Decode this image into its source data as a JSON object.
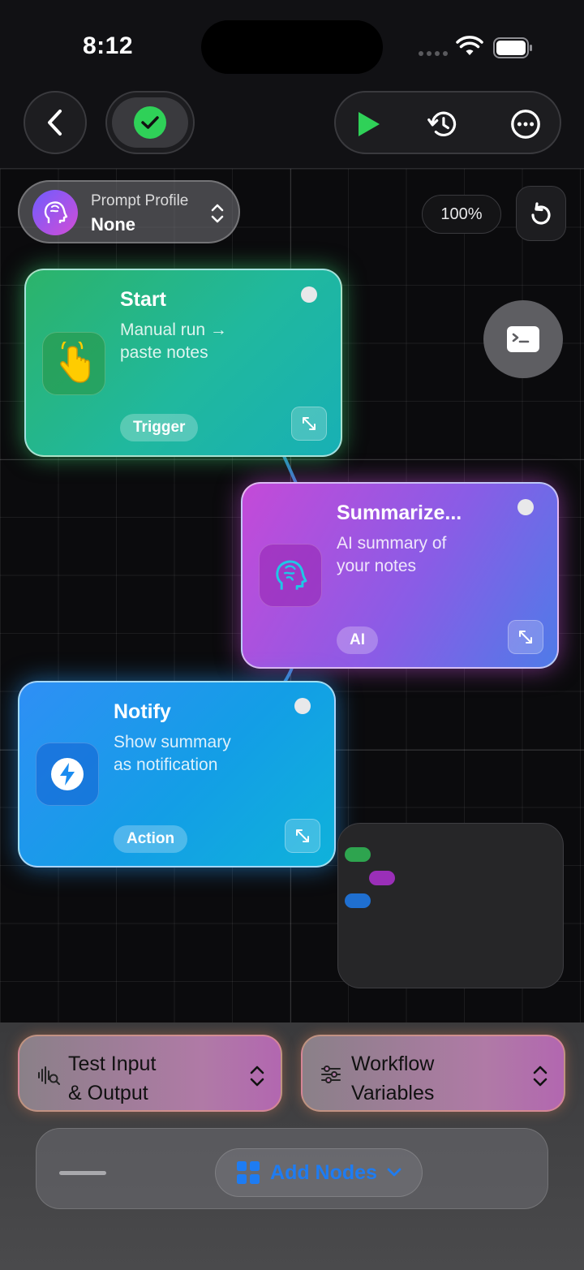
{
  "status_bar": {
    "time": "8:12"
  },
  "toolbar": {
    "back_icon": "chevron-left-icon",
    "status_icon": "checkmark-icon",
    "run_icon": "play-icon",
    "history_icon": "history-icon",
    "more_icon": "ellipsis-icon",
    "run_color": "#2fd158"
  },
  "prompt_profile": {
    "label": "Prompt Profile",
    "value": "None",
    "icon": "brain-head-icon"
  },
  "canvas": {
    "zoom": "100%"
  },
  "nodes": [
    {
      "title": "Start",
      "desc_line1": "Manual run →",
      "desc_line2": "paste notes",
      "tag": "Trigger",
      "icon": "hand-tap-icon"
    },
    {
      "title": "Summarize...",
      "desc_line1": "AI summary of",
      "desc_line2": "your notes",
      "tag": "AI",
      "icon": "brain-head-icon"
    },
    {
      "title": "Notify",
      "desc_line1": "Show summary",
      "desc_line2": "as notification",
      "tag": "Action",
      "icon": "bolt-icon"
    }
  ],
  "minimap_colors": [
    "#2ea44f",
    "#9a2fb8",
    "#1f6fd0"
  ],
  "bottom": {
    "test_io": {
      "line1": "Test Input",
      "line2": "& Output"
    },
    "variables": {
      "line1": "Workflow",
      "line2": "Variables"
    },
    "add_nodes": "Add Nodes"
  }
}
